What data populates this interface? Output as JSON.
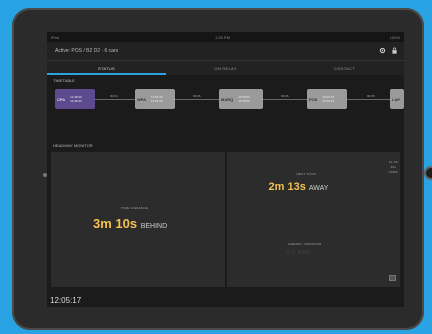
{
  "statusbar": {
    "left": "iPad",
    "center": "1:25 PM",
    "right": "100%"
  },
  "header": {
    "title": "Active: POS / B2 D2 · 6 cars"
  },
  "tabs": [
    {
      "label": "STATUS",
      "active": true
    },
    {
      "label": "ON RELAY",
      "active": false
    },
    {
      "label": "CONTACT",
      "active": false
    }
  ],
  "timetable": {
    "label": "TIMETABLE",
    "stops": [
      {
        "code": "CPA",
        "times": [
          "11:48:30",
          "11:48:30"
        ],
        "active": true
      },
      {
        "code": "WPA",
        "times": [
          "11:52:40",
          "11:52:40"
        ],
        "active": false
      },
      {
        "code": "MARQ",
        "times": [
          "11:58:50",
          "11:58:50"
        ],
        "active": false
      },
      {
        "code": "POS",
        "times": [
          "12:04:10",
          "12:04:10"
        ],
        "active": false
      },
      {
        "code": "LAP",
        "times": [],
        "active": false
      }
    ],
    "segments": [
      "00:04",
      "00:06",
      "00:06",
      "00:05"
    ]
  },
  "headway": {
    "label": "HEADWAY MONITOR"
  },
  "left_panel": {
    "label": "TIME VARIANCE",
    "value": "3m 10s",
    "word": "BEHIND"
  },
  "right_panel": {
    "next_label": "NEXT STOP",
    "next_value": "2m 13s",
    "next_word": "AWAY",
    "energy_label": "ENERGY VARIANCE",
    "energy_value": "0.0 kWh"
  },
  "side": {
    "top": "12:06",
    "mid": "40s",
    "bot": "CARS"
  },
  "clock": "12:05:17",
  "colors": {
    "accent": "#29a3e3",
    "highlight": "#f2c14e",
    "active_stop": "#5d4a8f"
  }
}
